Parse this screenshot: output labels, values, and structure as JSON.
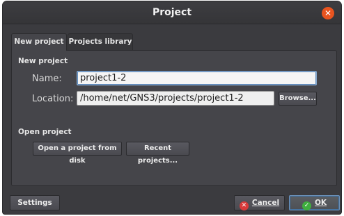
{
  "window": {
    "title": "Project"
  },
  "tabs": [
    {
      "label": "New project",
      "active": true
    },
    {
      "label": "Projects library",
      "active": false
    }
  ],
  "new_project": {
    "heading": "New project",
    "name_label": "Name:",
    "name_value": "project1-2",
    "location_label": "Location:",
    "location_value": "/home/net/GNS3/projects/project1-2",
    "browse_label": "Browse..."
  },
  "open_project": {
    "heading": "Open project",
    "open_disk_label": "Open a project from disk",
    "recent_label": "Recent projects..."
  },
  "footer": {
    "settings_label": "Settings",
    "cancel_label": "Cancel",
    "ok_label": "OK"
  },
  "icons": {
    "close": "close-icon",
    "cancel": "cancel-icon",
    "ok": "check-icon"
  },
  "colors": {
    "window_bg": "#3b3b3f",
    "panel_bg": "#45454a",
    "close_button": "#e9541f",
    "cancel_icon": "#d83a3a",
    "ok_icon": "#3fae3f",
    "focus_border": "#5e88b8"
  }
}
